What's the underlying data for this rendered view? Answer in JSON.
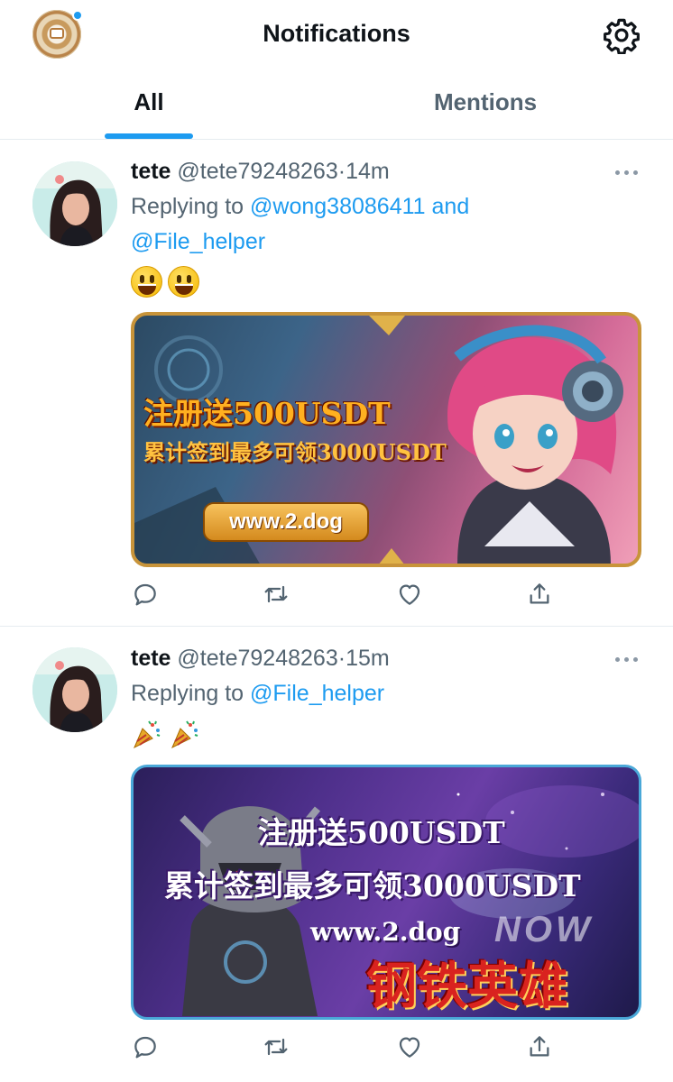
{
  "header": {
    "title": "Notifications",
    "settings_icon": "gear-icon",
    "avatar_icon": "profile-avatar",
    "badge_color": "#1d9bf0"
  },
  "tabs": [
    {
      "label": "All",
      "active": true
    },
    {
      "label": "Mentions",
      "active": false
    }
  ],
  "colors": {
    "accent": "#1d9bf0",
    "text": "#0f1419",
    "muted": "#536471"
  },
  "tweets": [
    {
      "name": "tete",
      "handle": "@tete79248263",
      "separator": "·",
      "time": "14m",
      "replying_prefix": "Replying to",
      "mention_1": "@wong38086411",
      "conjunction": "and",
      "mention_2": "@File_helper",
      "emoji": "smiley-face ×2",
      "banner": {
        "line1": "注册送500USDT",
        "line2": "累计签到最多可领3000USDT",
        "url": "www.2.dog"
      }
    },
    {
      "name": "tete",
      "handle": "@tete79248263",
      "separator": "·",
      "time": "15m",
      "replying_prefix": "Replying to",
      "mention_1": "@File_helper",
      "emoji": "party-popper ×2",
      "banner": {
        "line1": "注册送500USDT",
        "line2": "累计签到最多可领3000USDT",
        "url": "www.2.dog",
        "overlay": "NOW",
        "game_title": "钢铁英雄"
      }
    }
  ],
  "actions": [
    "reply-icon",
    "retweet-icon",
    "like-icon",
    "share-icon"
  ]
}
